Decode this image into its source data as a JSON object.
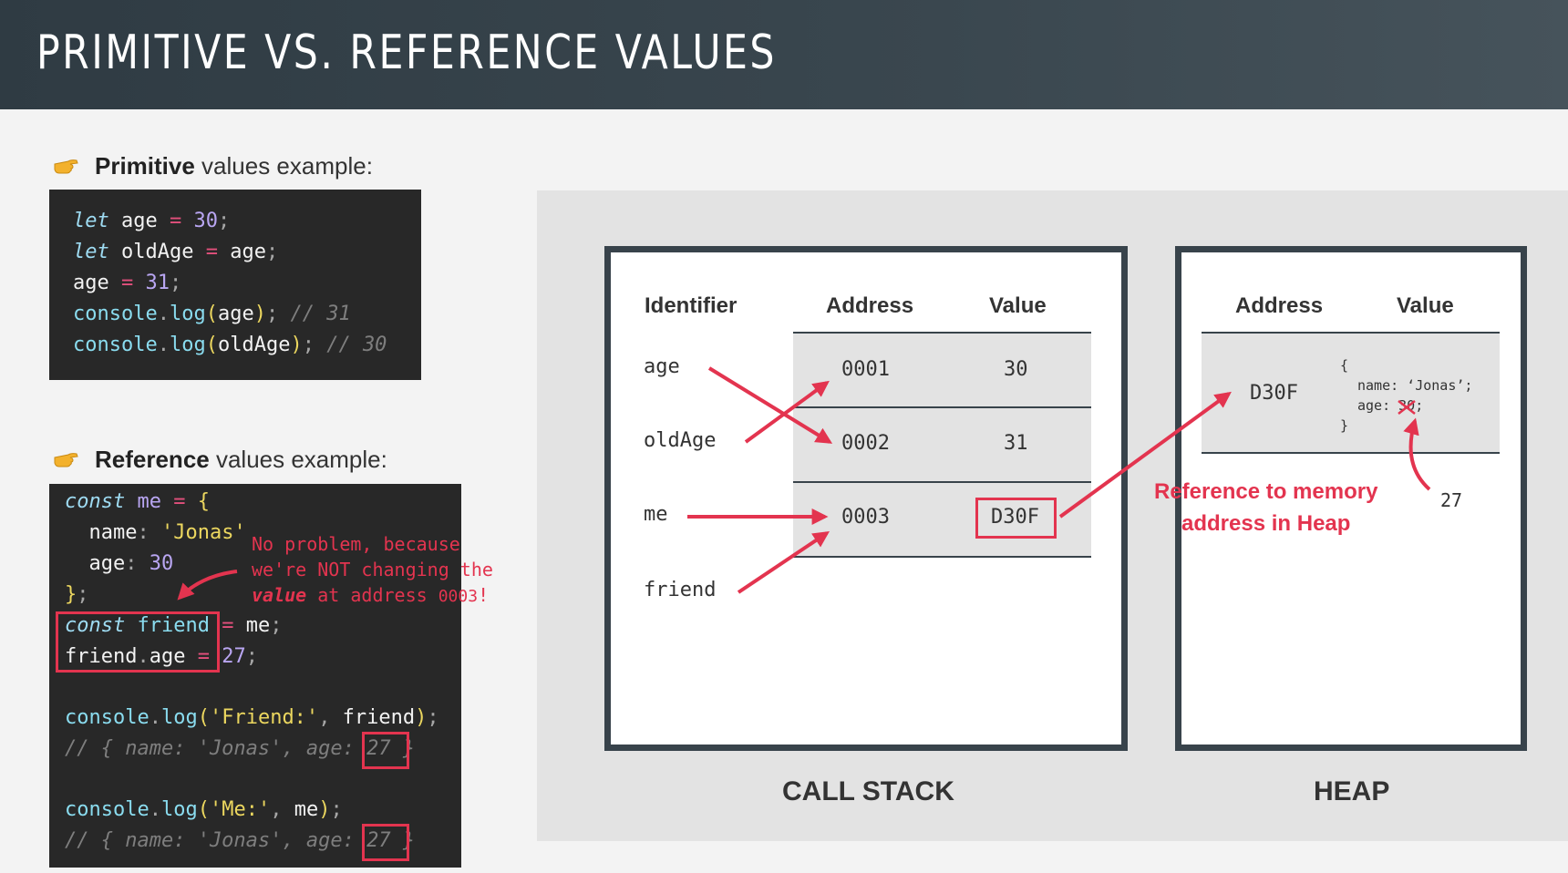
{
  "header": {
    "title": "PRIMITIVE VS. REFERENCE VALUES"
  },
  "primitive": {
    "heading_bold": "Primitive",
    "heading_rest": " values example:",
    "icon": "pointing-hand-icon"
  },
  "reference": {
    "heading_bold": "Reference",
    "heading_rest": " values example:",
    "icon": "pointing-hand-icon"
  },
  "annotation": {
    "line1": "No problem, because",
    "line2": "we're NOT changing the",
    "line3_bold": "value",
    "line3_mid": " at address ",
    "line3_code": "0003",
    "line3_end": "!"
  },
  "call_stack": {
    "caption": "CALL STACK",
    "headers": {
      "identifier": "Identifier",
      "address": "Address",
      "value": "Value"
    },
    "identifiers": [
      "age",
      "oldAge",
      "me",
      "friend"
    ],
    "rows": [
      {
        "address": "0001",
        "value": "30"
      },
      {
        "address": "0002",
        "value": "31"
      },
      {
        "address": "0003",
        "value": "D30F"
      }
    ]
  },
  "heap": {
    "caption": "HEAP",
    "headers": {
      "address": "Address",
      "value": "Value"
    },
    "address": "D30F",
    "object": {
      "open": "{",
      "name_line": "name: ‘Jonas’;",
      "age_key": "age: ",
      "age_old": "30",
      "age_end": ";",
      "close": "}"
    },
    "new_age": "27"
  },
  "ref_label": {
    "line1": "Reference to memory",
    "line2": "address in Heap"
  },
  "colors": {
    "accent": "#e3344f",
    "header_bg": "#2f3b43",
    "box_border": "#38434b",
    "code_bg": "#282828"
  }
}
